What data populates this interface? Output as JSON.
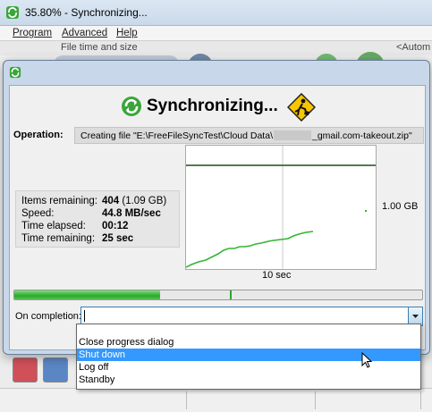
{
  "window": {
    "title": "35.80% - Synchronizing..."
  },
  "menu": {
    "program": "Program",
    "advanced": "Advanced",
    "help": "Help"
  },
  "strip": {
    "left_header": "File time and size",
    "right_header": "<Autom"
  },
  "dialog": {
    "title": "Synchronizing...",
    "operation_label": "Operation:",
    "operation_prefix": "Creating file \"E:\\FreeFileSyncTest\\Cloud Data\\",
    "operation_suffix": "_gmail.com-takeout.zip\"",
    "stats": {
      "items_remaining_label": "Items remaining:",
      "items_remaining_value": "404",
      "items_remaining_size": "(1.09 GB)",
      "speed_label": "Speed:",
      "speed_value": "44.8 MB/sec",
      "time_elapsed_label": "Time elapsed:",
      "time_elapsed_value": "00:12",
      "time_remaining_label": "Time remaining:",
      "time_remaining_value": "25 sec"
    },
    "graph": {
      "x_label": "10 sec",
      "y_label": "1.00 GB"
    },
    "progress_fraction": 0.358,
    "on_completion_label": "On completion:",
    "on_completion_value": "",
    "dropdown_options": [
      "Close progress dialog",
      "Shut down",
      "Log off",
      "Standby"
    ],
    "dropdown_selected_index": 1
  },
  "colors": {
    "accent_green": "#2ba82b",
    "selection": "#3399ff",
    "dialog_frame": "#c8d8ea"
  },
  "icons": [
    "freefilesync-icon",
    "sync-arrows-icon",
    "work-in-progress-icon",
    "dropdown-arrow-icon",
    "mouse-cursor-icon"
  ]
}
